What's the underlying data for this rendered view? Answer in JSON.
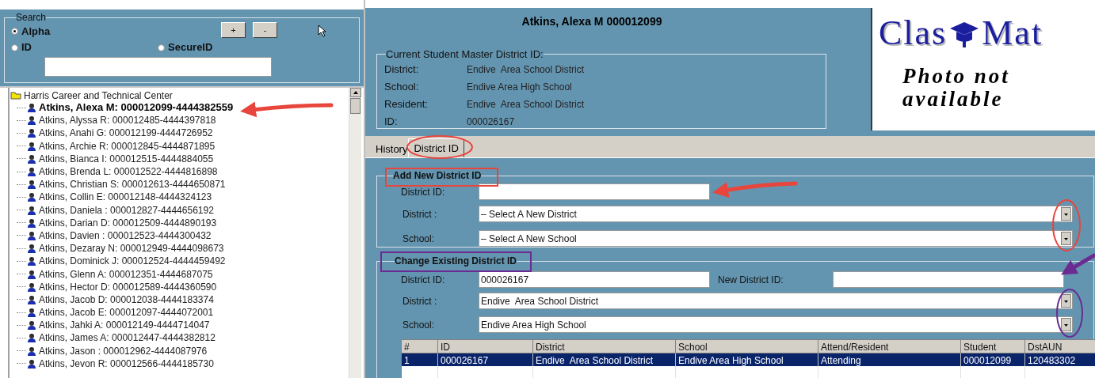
{
  "search": {
    "title": "Search",
    "options": [
      {
        "label": "Alpha",
        "selected": true
      },
      {
        "label": "ID",
        "selected": false
      },
      {
        "label": "SecureID",
        "selected": false
      }
    ],
    "buttons": [
      "+",
      "-"
    ]
  },
  "tree": {
    "label": "Harris Career and Technical Center",
    "children": [
      {
        "label": "Atkins, Alexa M: 000012099-4444382559",
        "selected": true
      },
      {
        "label": "Atkins, Alyssa R: 000012485-4444397818",
        "selected": false
      },
      {
        "label": "Atkins, Anahi G: 000012199-4444726952",
        "selected": false
      },
      {
        "label": "Atkins, Archie R: 000012845-4444871895",
        "selected": false
      },
      {
        "label": "Atkins, Bianca I: 000012515-4444884055",
        "selected": false
      },
      {
        "label": "Atkins, Brenda L: 000012522-4444816898",
        "selected": false
      },
      {
        "label": "Atkins, Christian S: 000012613-4444650871",
        "selected": false
      },
      {
        "label": "Atkins, Collin E: 000012148-4444324123",
        "selected": false
      },
      {
        "label": "Atkins, Daniela : 000012827-4444656192",
        "selected": false
      },
      {
        "label": "Atkins, Darian D: 000012509-4444890193",
        "selected": false
      },
      {
        "label": "Atkins, Davien : 000012523-4444300432",
        "selected": false
      },
      {
        "label": "Atkins, Dezaray N: 000012949-4444098673",
        "selected": false
      },
      {
        "label": "Atkins, Dominick J: 000012524-4444459492",
        "selected": false
      },
      {
        "label": "Atkins, Glenn A: 000012351-4444687075",
        "selected": false
      },
      {
        "label": "Atkins, Hector D: 000012589-4444360590",
        "selected": false
      },
      {
        "label": "Atkins, Jacob D: 000012038-4444183374",
        "selected": false
      },
      {
        "label": "Atkins, Jacob E: 000012097-4444072001",
        "selected": false
      },
      {
        "label": "Atkins, Jahki A: 000012149-4444714047",
        "selected": false
      },
      {
        "label": "Atkins, James A: 000012447-4444382812",
        "selected": false
      },
      {
        "label": "Atkins, Jason : 000012962-4444087976",
        "selected": false
      },
      {
        "label": "Atkins, Jevon R: 000012566-4444185730",
        "selected": false
      }
    ]
  },
  "student_title": "Atkins, Alexa M 000012099",
  "current": {
    "legend": "Current Student Master District ID:",
    "fields": [
      {
        "label": "District:",
        "value": "Endive  Area School District"
      },
      {
        "label": "School:",
        "value": "Endive Area High School"
      },
      {
        "label": "Resident:",
        "value": "Endive  Area School District"
      },
      {
        "label": "ID:",
        "value": "000026167"
      }
    ]
  },
  "logo": {
    "left": "Clas",
    "right": "Mat",
    "photo_text": "Photo not available"
  },
  "tabs": [
    {
      "label": "History",
      "selected": false
    },
    {
      "label": "District ID",
      "selected": true
    }
  ],
  "add_new": {
    "legend": "Add New District ID",
    "id_label": "District ID:",
    "district_label": "District :",
    "district_value": "– Select A New District",
    "school_label": "School:",
    "school_value": "– Select A New School"
  },
  "change_existing": {
    "legend": "Change Existing District ID",
    "id_label": "District ID:",
    "id_value": "000026167",
    "new_id_label": "New District ID:",
    "district_label": "District :",
    "district_value": "Endive  Area School District",
    "school_label": "School:",
    "school_value": "Endive Area High School"
  },
  "table": {
    "columns": [
      "#",
      "ID",
      "District",
      "School",
      "Attend/Resident",
      "Student",
      "DstAUN"
    ],
    "rows": [
      {
        "cells": [
          "1",
          "000026167",
          "Endive  Area School District",
          "Endive Area High School",
          "Attending",
          "000012099",
          "120483302"
        ],
        "selected": true
      }
    ]
  }
}
